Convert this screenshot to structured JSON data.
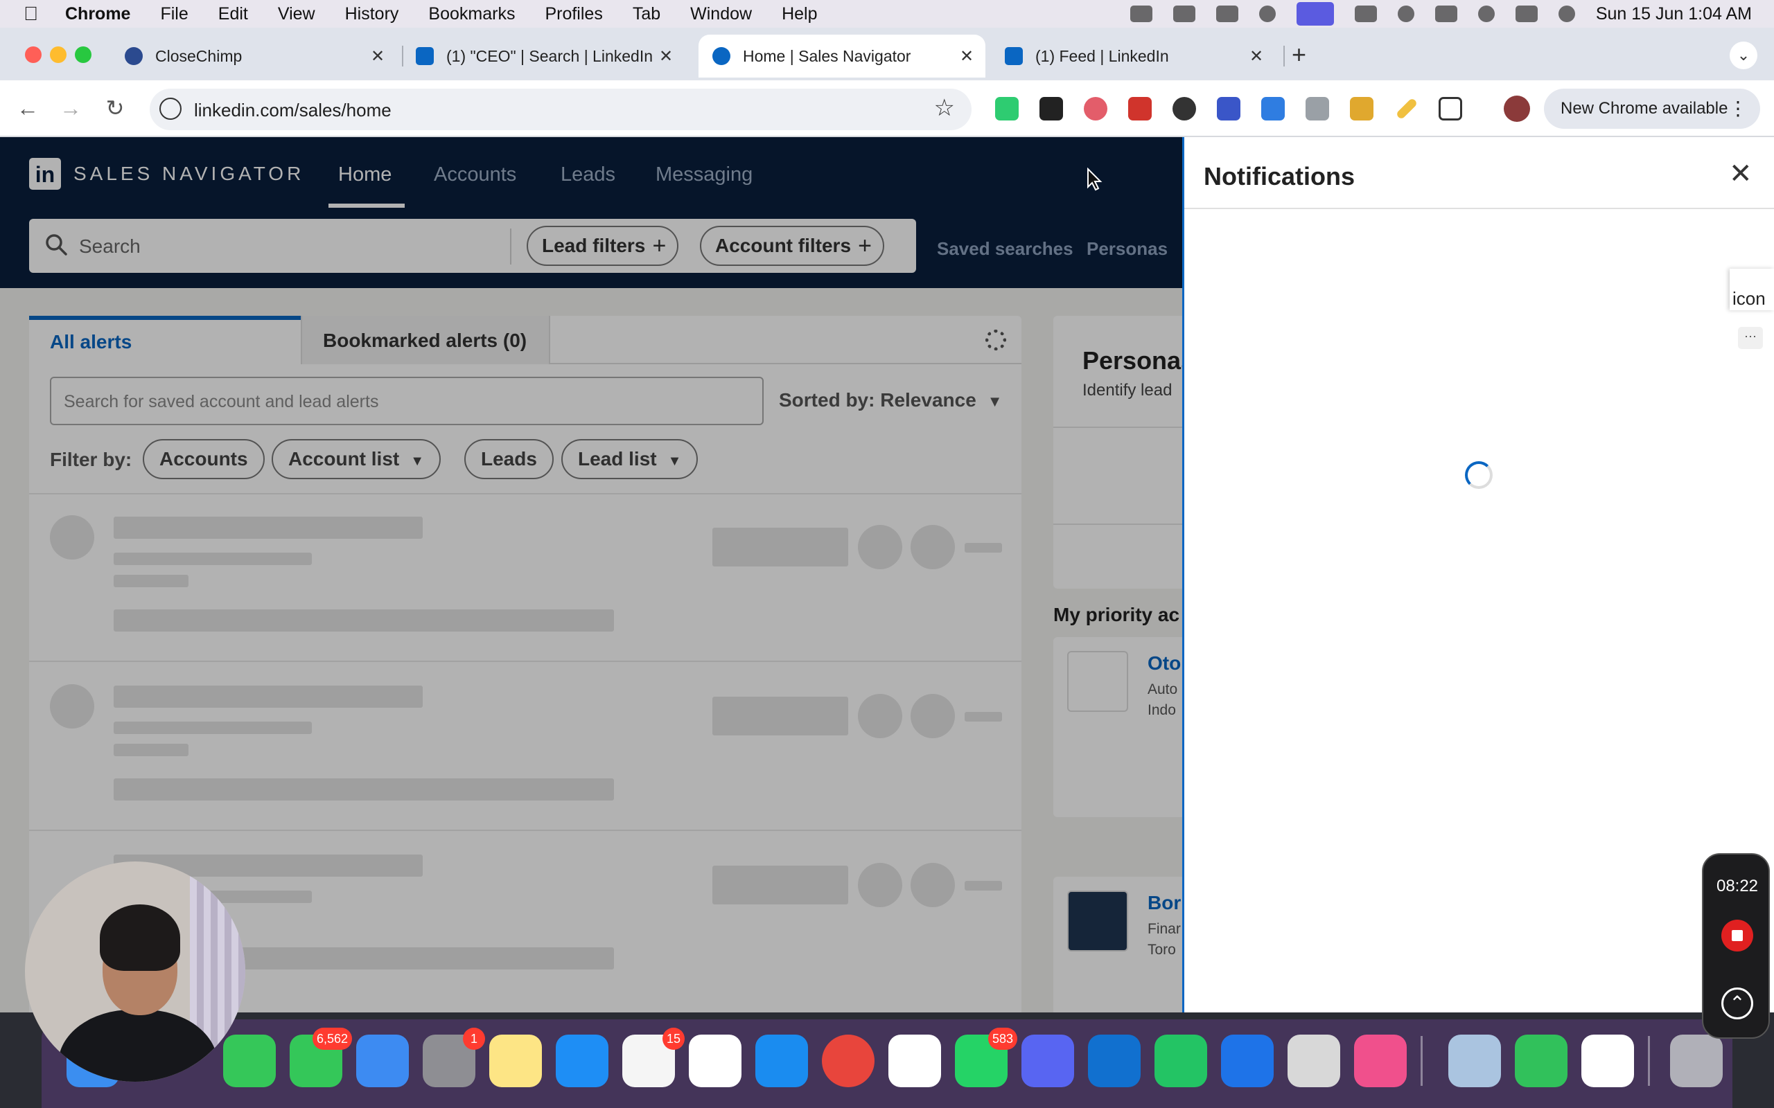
{
  "menubar": {
    "app": "Chrome",
    "items": [
      "File",
      "Edit",
      "View",
      "History",
      "Bookmarks",
      "Profiles",
      "Tab",
      "Window",
      "Help"
    ],
    "datetime": "Sun 15 Jun  1:04 AM"
  },
  "tabs": [
    {
      "title": "CloseChimp",
      "favicon": "closechimp-icon"
    },
    {
      "title": "(1) \"CEO\" | Search | LinkedIn",
      "favicon": "linkedin-icon"
    },
    {
      "title": "Home | Sales Navigator",
      "favicon": "sales-navigator-icon"
    },
    {
      "title": "(1) Feed | LinkedIn",
      "favicon": "linkedin-icon"
    }
  ],
  "toolbar": {
    "url": "linkedin.com/sales/home",
    "new_chrome": "New Chrome available"
  },
  "salesnav": {
    "logo_in": "in",
    "logo_word": "SALES NAVIGATOR",
    "nav": [
      "Home",
      "Accounts",
      "Leads",
      "Messaging"
    ],
    "search_placeholder": "Search",
    "lead_filters": "Lead filters",
    "account_filters": "Account filters",
    "saved_searches": "Saved searches",
    "personas": "Personas"
  },
  "alerts": {
    "tab_all": "All alerts",
    "tab_bookmarked": "Bookmarked alerts (0)",
    "search_placeholder": "Search for saved account and lead alerts",
    "sorted": "Sorted by: Relevance",
    "filter_by": "Filter by:",
    "pills": [
      "Accounts",
      "Account list",
      "Leads",
      "Lead list"
    ]
  },
  "right": {
    "title": "Personas",
    "subtitle": "Identify lead",
    "priority": "My priority ac",
    "cards": [
      {
        "name": "Oto",
        "line1": "Auto",
        "line2": "Indo"
      },
      {
        "name": "Bor",
        "line1": "Finar",
        "line2": "Toro"
      }
    ]
  },
  "notifications": {
    "title": "Notifications",
    "side_icon_alt": "icon"
  },
  "recorder": {
    "time": "08:22"
  },
  "dock": {
    "badges": {
      "messages": "6,562",
      "settings": "1",
      "reminders": "15",
      "whatsapp": "583"
    }
  },
  "colors": {
    "linkedin_blue": "#0a66c2",
    "salesnav_navy": "#0a1f3d",
    "record_red": "#e02020"
  }
}
